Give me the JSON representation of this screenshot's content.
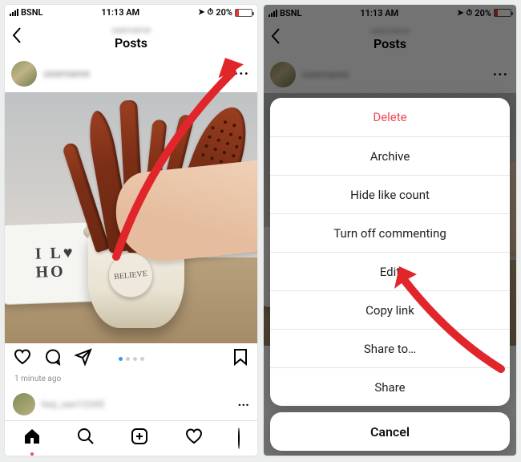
{
  "status": {
    "carrier": "BSNL",
    "time": "11:13 AM",
    "loc_glyph": "➤",
    "alarm_glyph": "⏱",
    "battery_pct": "20%",
    "battery_level": 20
  },
  "igHeader": {
    "back_glyph": "‹",
    "title": "Posts",
    "subtitle": "username"
  },
  "post": {
    "username": "username",
    "more_glyph": "···",
    "timestamp": "1 minute ago",
    "tag_text": "BELIEVE",
    "plate_text": "I   L♥\nHO",
    "carousel_index": 0,
    "carousel_count": 4
  },
  "actions": {
    "like": "heart-icon",
    "comment": "comment-icon",
    "share": "send-icon",
    "save": "bookmark-icon"
  },
  "next": {
    "username": "hey_san12345",
    "more_glyph": "···"
  },
  "tabs": {
    "home": "home-icon",
    "search": "search-icon",
    "create": "add-icon",
    "activity": "heart-icon",
    "profile": "profile-icon"
  },
  "actionSheet": {
    "items": [
      {
        "label": "Delete",
        "destructive": true
      },
      {
        "label": "Archive",
        "destructive": false
      },
      {
        "label": "Hide like count",
        "destructive": false
      },
      {
        "label": "Turn off commenting",
        "destructive": false
      },
      {
        "label": "Edit",
        "destructive": false
      },
      {
        "label": "Copy link",
        "destructive": false
      },
      {
        "label": "Share to…",
        "destructive": false
      },
      {
        "label": "Share",
        "destructive": false
      }
    ],
    "cancel": "Cancel"
  }
}
